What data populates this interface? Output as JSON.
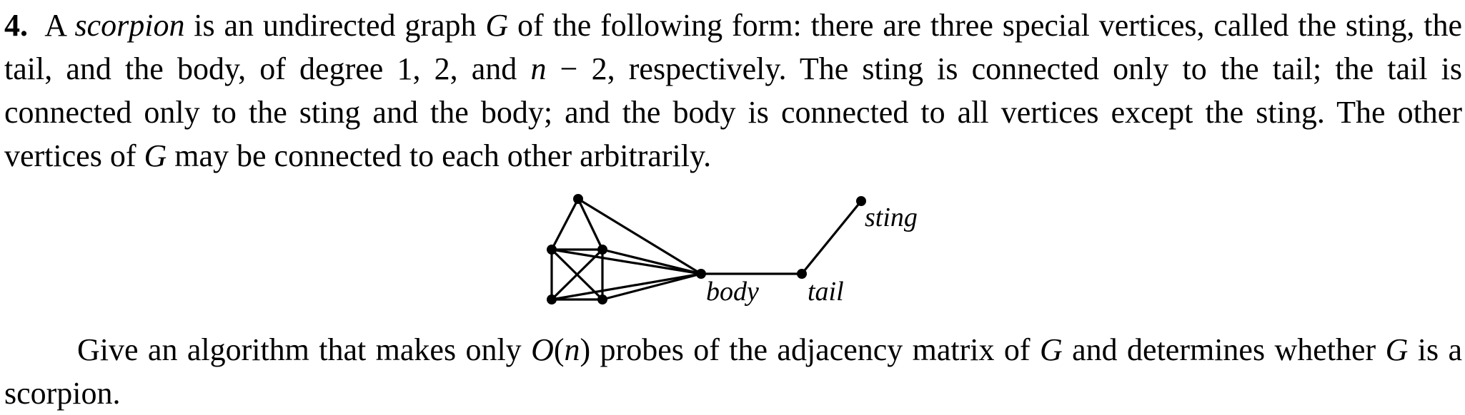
{
  "problem": {
    "number": "4.",
    "para1": {
      "t1": "A ",
      "term": "scorpion",
      "t2": " is an undirected graph ",
      "G1": "G",
      "t3": " of the following form: there are three special vertices, called the sting, the tail, and the body, of degree ",
      "deg1": "1",
      "t4": ", ",
      "deg2": "2",
      "t5": ", and ",
      "n": "n",
      "minus": " − ",
      "two": "2",
      "t6": ", respectively. The sting is connected only to the tail; the tail is connected only to the sting and the body; and the body is connected to all vertices except the sting. The other vertices of ",
      "G2": "G",
      "t7": " may be connected to each other arbitrarily."
    },
    "figure": {
      "labels": {
        "sting": "sting",
        "body": "body",
        "tail": "tail"
      }
    },
    "para2": {
      "t1": "Give an algorithm that makes only ",
      "O": "O",
      "lp": "(",
      "n": "n",
      "rp": ")",
      "t2": " probes of the adjacency matrix of ",
      "G1": "G",
      "t3": " and determines whether ",
      "G2": "G",
      "t4": " is a scorpion."
    }
  }
}
